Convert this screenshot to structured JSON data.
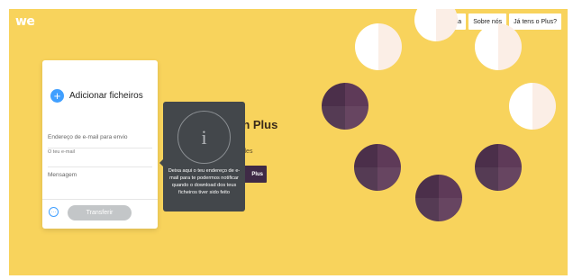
{
  "logo": "we",
  "nav": {
    "items": [
      "Ajuda",
      "Sobre nós",
      "Já tens o Plus?"
    ]
  },
  "hero": {
    "title": "th Plus",
    "subline1": "y",
    "subline2": "tiles",
    "button": "Plus"
  },
  "panel": {
    "add_files_label": "Adicionar ficheiros",
    "recipient_placeholder": "Endereço de e-mail para envio",
    "sender_placeholder": "O teu e-mail",
    "message_placeholder": "Mensagem",
    "transfer_label": "Transferir",
    "options_icon": "ellipsis-icon"
  },
  "tooltip": {
    "icon": "info-icon",
    "text": "Deixa aqui o teu endereço de e-mail para te podermos notificar quando o download dos teus ficheiros tiver sido feito"
  },
  "colors": {
    "background": "#f8d35c",
    "accent": "#409fff",
    "tooltip_bg": "#43474b",
    "circle_dark": "#5e3a58",
    "circle_light": "#ffffff"
  }
}
